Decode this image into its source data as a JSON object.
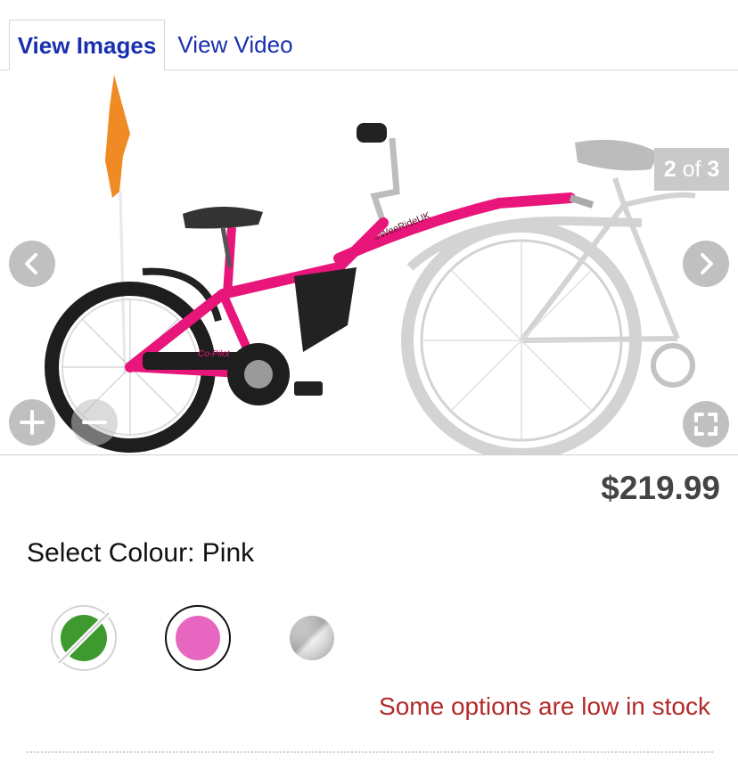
{
  "tabs": [
    {
      "label": "View Images",
      "active": true
    },
    {
      "label": "View Video",
      "active": false
    }
  ],
  "gallery": {
    "current": "2",
    "of_label": "of",
    "total": "3",
    "icons": [
      "chevron-left-icon",
      "chevron-right-icon",
      "zoom-in-icon",
      "zoom-out-icon",
      "fullscreen-icon"
    ],
    "image_watermark": "©WeeRideUK",
    "frame_decal": "Co-Pilot"
  },
  "product": {
    "price": "$219.99",
    "select_colour_label": "Select Colour:",
    "selected_colour": "Pink",
    "swatches": [
      {
        "name": "Green",
        "color": "#3e9a2e",
        "available": false
      },
      {
        "name": "Pink",
        "color": "#e766c0",
        "available": true,
        "selected": true
      },
      {
        "name": "Silver",
        "color": "#c8c8c8",
        "available": true
      }
    ],
    "stock_message": "Some options are low in stock"
  },
  "colors": {
    "tab_text": "#1a2fb0",
    "price_text": "#444444",
    "stock_text": "#b22a2a",
    "bike_pink": "#e8157a",
    "flag_orange": "#f08a24"
  }
}
